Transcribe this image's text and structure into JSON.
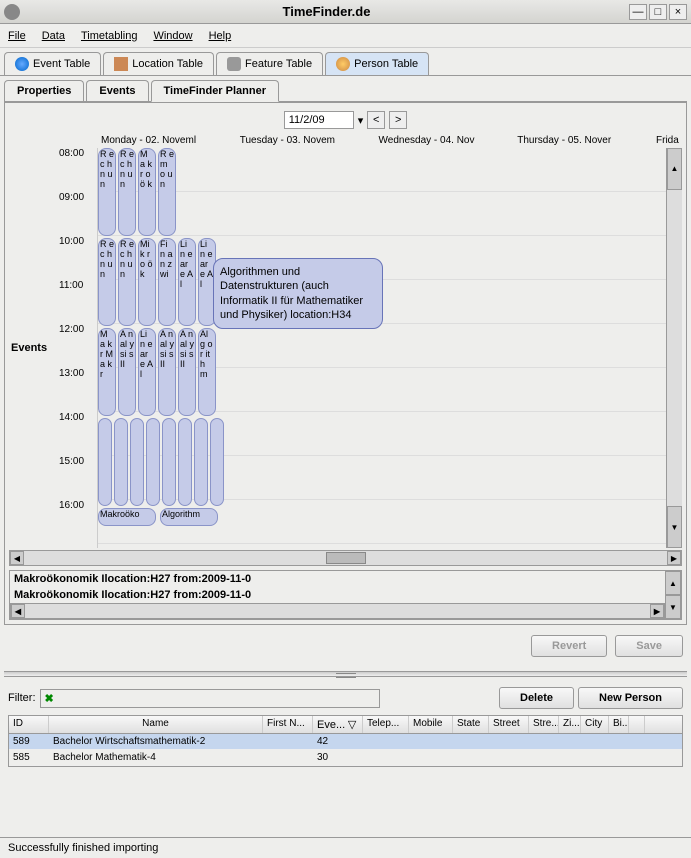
{
  "window": {
    "title": "TimeFinder.de"
  },
  "menu": {
    "file": "File",
    "data": "Data",
    "timetabling": "Timetabling",
    "window": "Window",
    "help": "Help"
  },
  "mainTabs": {
    "event": "Event Table",
    "location": "Location Table",
    "feature": "Feature Table",
    "person": "Person Table"
  },
  "subTabs": {
    "properties": "Properties",
    "events": "Events",
    "planner": "TimeFinder Planner"
  },
  "dateField": "11/2/09",
  "eventsLabel": "Events",
  "days": {
    "mon": "Monday - 02. Noveml",
    "tue": "Tuesday - 03. Novem",
    "wed": "Wednesday - 04. Nov",
    "thu": "Thursday - 05. Nover",
    "fri": "Frida"
  },
  "times": {
    "t8": "08:00",
    "t9": "09:00",
    "t10": "10:00",
    "t11": "11:00",
    "t12": "12:00",
    "t13": "13:00",
    "t14": "14:00",
    "t15": "15:00",
    "t16": "16:00"
  },
  "tooltip": "Algorithmen und Datenstrukturen (auch Informatik II für Mathematiker und Physiker)\nlocation:H34",
  "blocks": {
    "r1c1": "R e c h n u n",
    "r1c2": "R e c h n u n",
    "r1c3": "M a k r o ö k",
    "r1c4": "R e m o u n",
    "r2c1": "R e c h n u n",
    "r2c2": "R e c h n u n",
    "r2c3": "Mi k r o ö k",
    "r2c4": "Fi n a n z wi",
    "r2c5": "Li n e ar e Al",
    "r2c6": "Li n e ar e Al",
    "r3c1": "M a kr M a kr",
    "r3c2": "A n al y si s II",
    "r3c3": "Li n e ar e Al",
    "r3c4": "A n al y si s II",
    "r3c5": "A n al y si s II",
    "r3c6": "Al g or it h m",
    "r4c1": "Makroöko",
    "r4c2": "Algorithm"
  },
  "details": {
    "line1": "Makroökonomik Ilocation:H27 from:2009-11-0",
    "line2": "Makroökonomik Ilocation:H27 from:2009-11-0"
  },
  "buttons": {
    "revert": "Revert",
    "save": "Save",
    "delete": "Delete",
    "newPerson": "New Person"
  },
  "filterLabel": "Filter:",
  "table": {
    "headers": {
      "id": "ID",
      "name": "Name",
      "firstName": "First N...",
      "events": "Eve...",
      "telephone": "Telep...",
      "mobile": "Mobile",
      "state": "State",
      "street": "Street",
      "stre": "Stre...",
      "zip": "Zi...",
      "city": "City",
      "bi": "Bi..."
    },
    "rows": [
      {
        "id": "589",
        "name": "Bachelor Wirtschaftsmathematik-2",
        "events": "42"
      },
      {
        "id": "585",
        "name": "Bachelor Mathematik-4",
        "events": "30"
      }
    ]
  },
  "status": "Successfully finished importing"
}
